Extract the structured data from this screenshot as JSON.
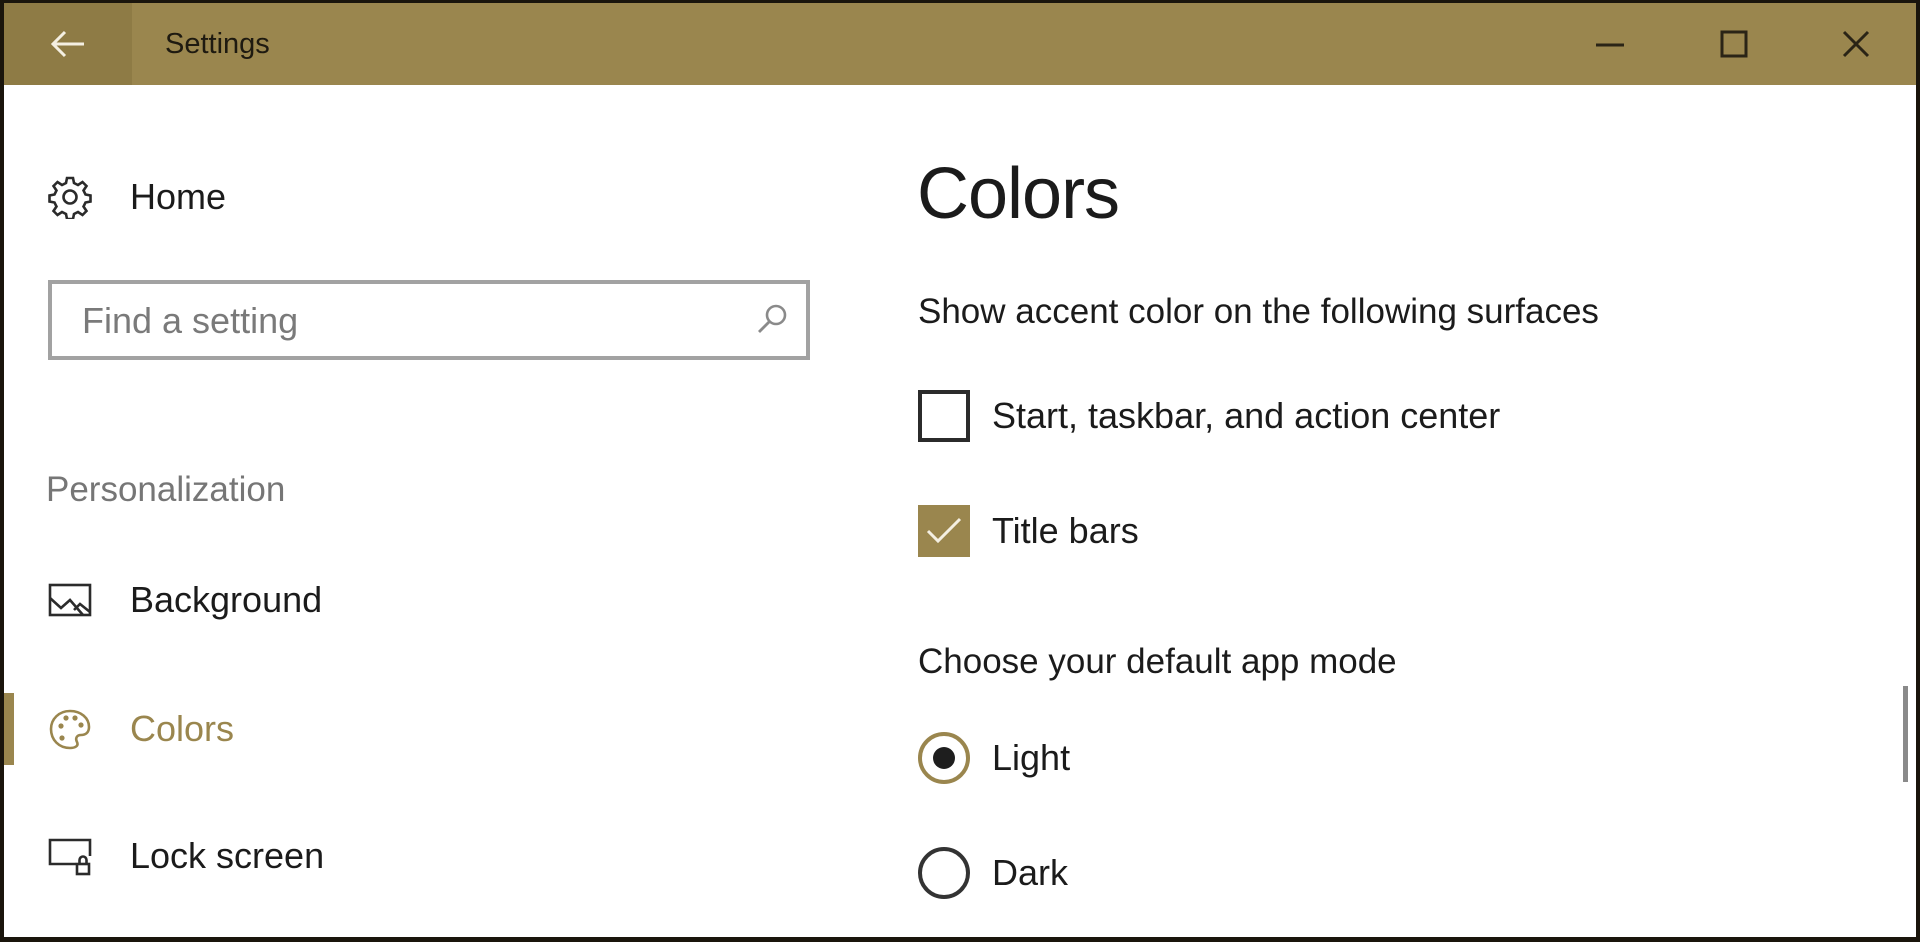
{
  "window": {
    "title": "Settings",
    "accent_color": "#9a864e",
    "controls": {
      "back": "back-arrow-icon",
      "minimize": "minimize-icon",
      "maximize": "maximize-icon",
      "close": "close-icon"
    }
  },
  "sidebar": {
    "home": {
      "label": "Home",
      "icon": "gear-icon"
    },
    "search": {
      "placeholder": "Find a setting",
      "value": "",
      "icon": "search-icon"
    },
    "section_label": "Personalization",
    "items": [
      {
        "label": "Background",
        "icon": "picture-icon",
        "active": false
      },
      {
        "label": "Colors",
        "icon": "palette-icon",
        "active": true
      },
      {
        "label": "Lock screen",
        "icon": "lock-screen-icon",
        "active": false
      }
    ]
  },
  "main": {
    "title": "Colors",
    "accent_surfaces": {
      "heading": "Show accent color on the following surfaces",
      "options": [
        {
          "label": "Start, taskbar, and action center",
          "checked": false
        },
        {
          "label": "Title bars",
          "checked": true
        }
      ]
    },
    "app_mode": {
      "heading": "Choose your default app mode",
      "options": [
        {
          "label": "Light",
          "selected": true
        },
        {
          "label": "Dark",
          "selected": false
        }
      ]
    }
  }
}
